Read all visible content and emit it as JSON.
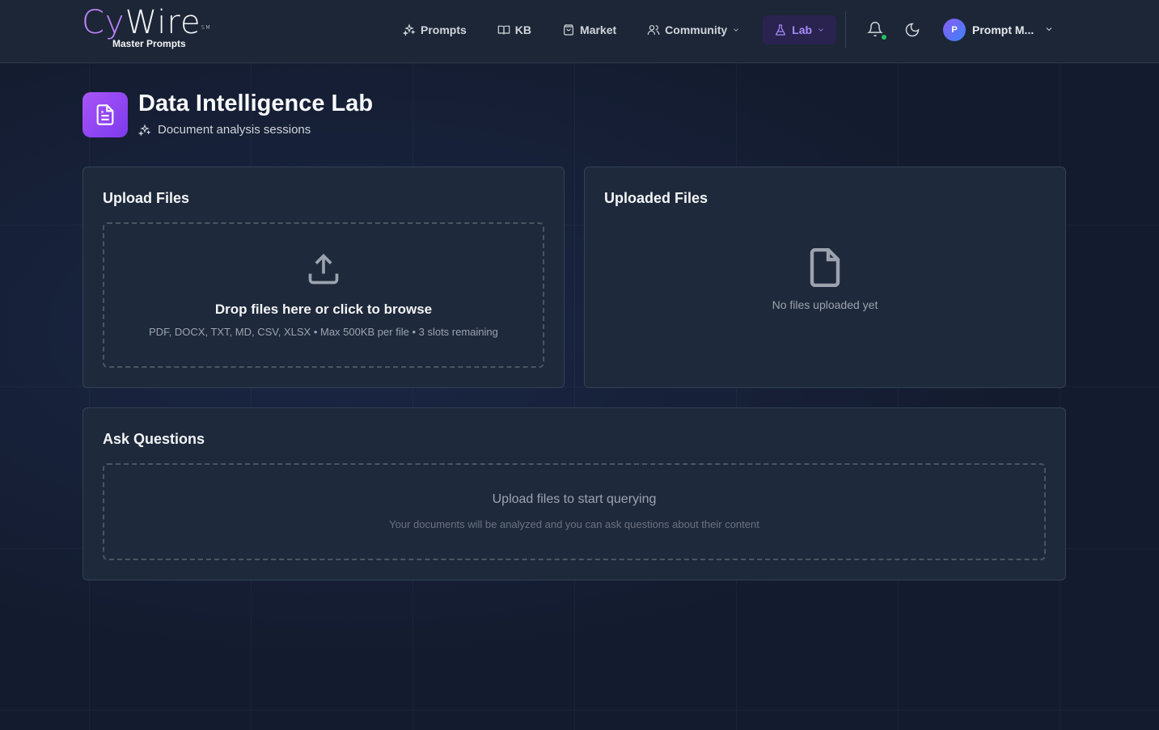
{
  "brand": {
    "logo_cy": "Cy",
    "logo_wire": "Wire",
    "logo_mark": "SM",
    "tagline": "Master Prompts"
  },
  "nav": {
    "items": [
      {
        "label": "Prompts",
        "icon": "sparkles-icon"
      },
      {
        "label": "KB",
        "icon": "book-icon"
      },
      {
        "label": "Market",
        "icon": "shopping-bag-icon"
      },
      {
        "label": "Community",
        "icon": "users-icon"
      },
      {
        "label": "Lab",
        "icon": "flask-icon"
      }
    ]
  },
  "user": {
    "initial": "P",
    "name": "Prompt M..."
  },
  "page": {
    "title": "Data Intelligence Lab",
    "subtitle": "Document analysis sessions"
  },
  "upload": {
    "title": "Upload Files",
    "drop_title": "Drop files here or click to browse",
    "drop_hint": "PDF, DOCX, TXT, MD, CSV, XLSX • Max 500KB per file • 3 slots remaining"
  },
  "uploaded": {
    "title": "Uploaded Files",
    "empty": "No files uploaded yet"
  },
  "ask": {
    "title": "Ask Questions",
    "main": "Upload files to start querying",
    "hint": "Your documents will be analyzed and you can ask questions about their content"
  },
  "colors": {
    "accent": "#a855f7",
    "background": "#131b2e",
    "card": "#1e293b",
    "status_online": "#22c55e"
  }
}
